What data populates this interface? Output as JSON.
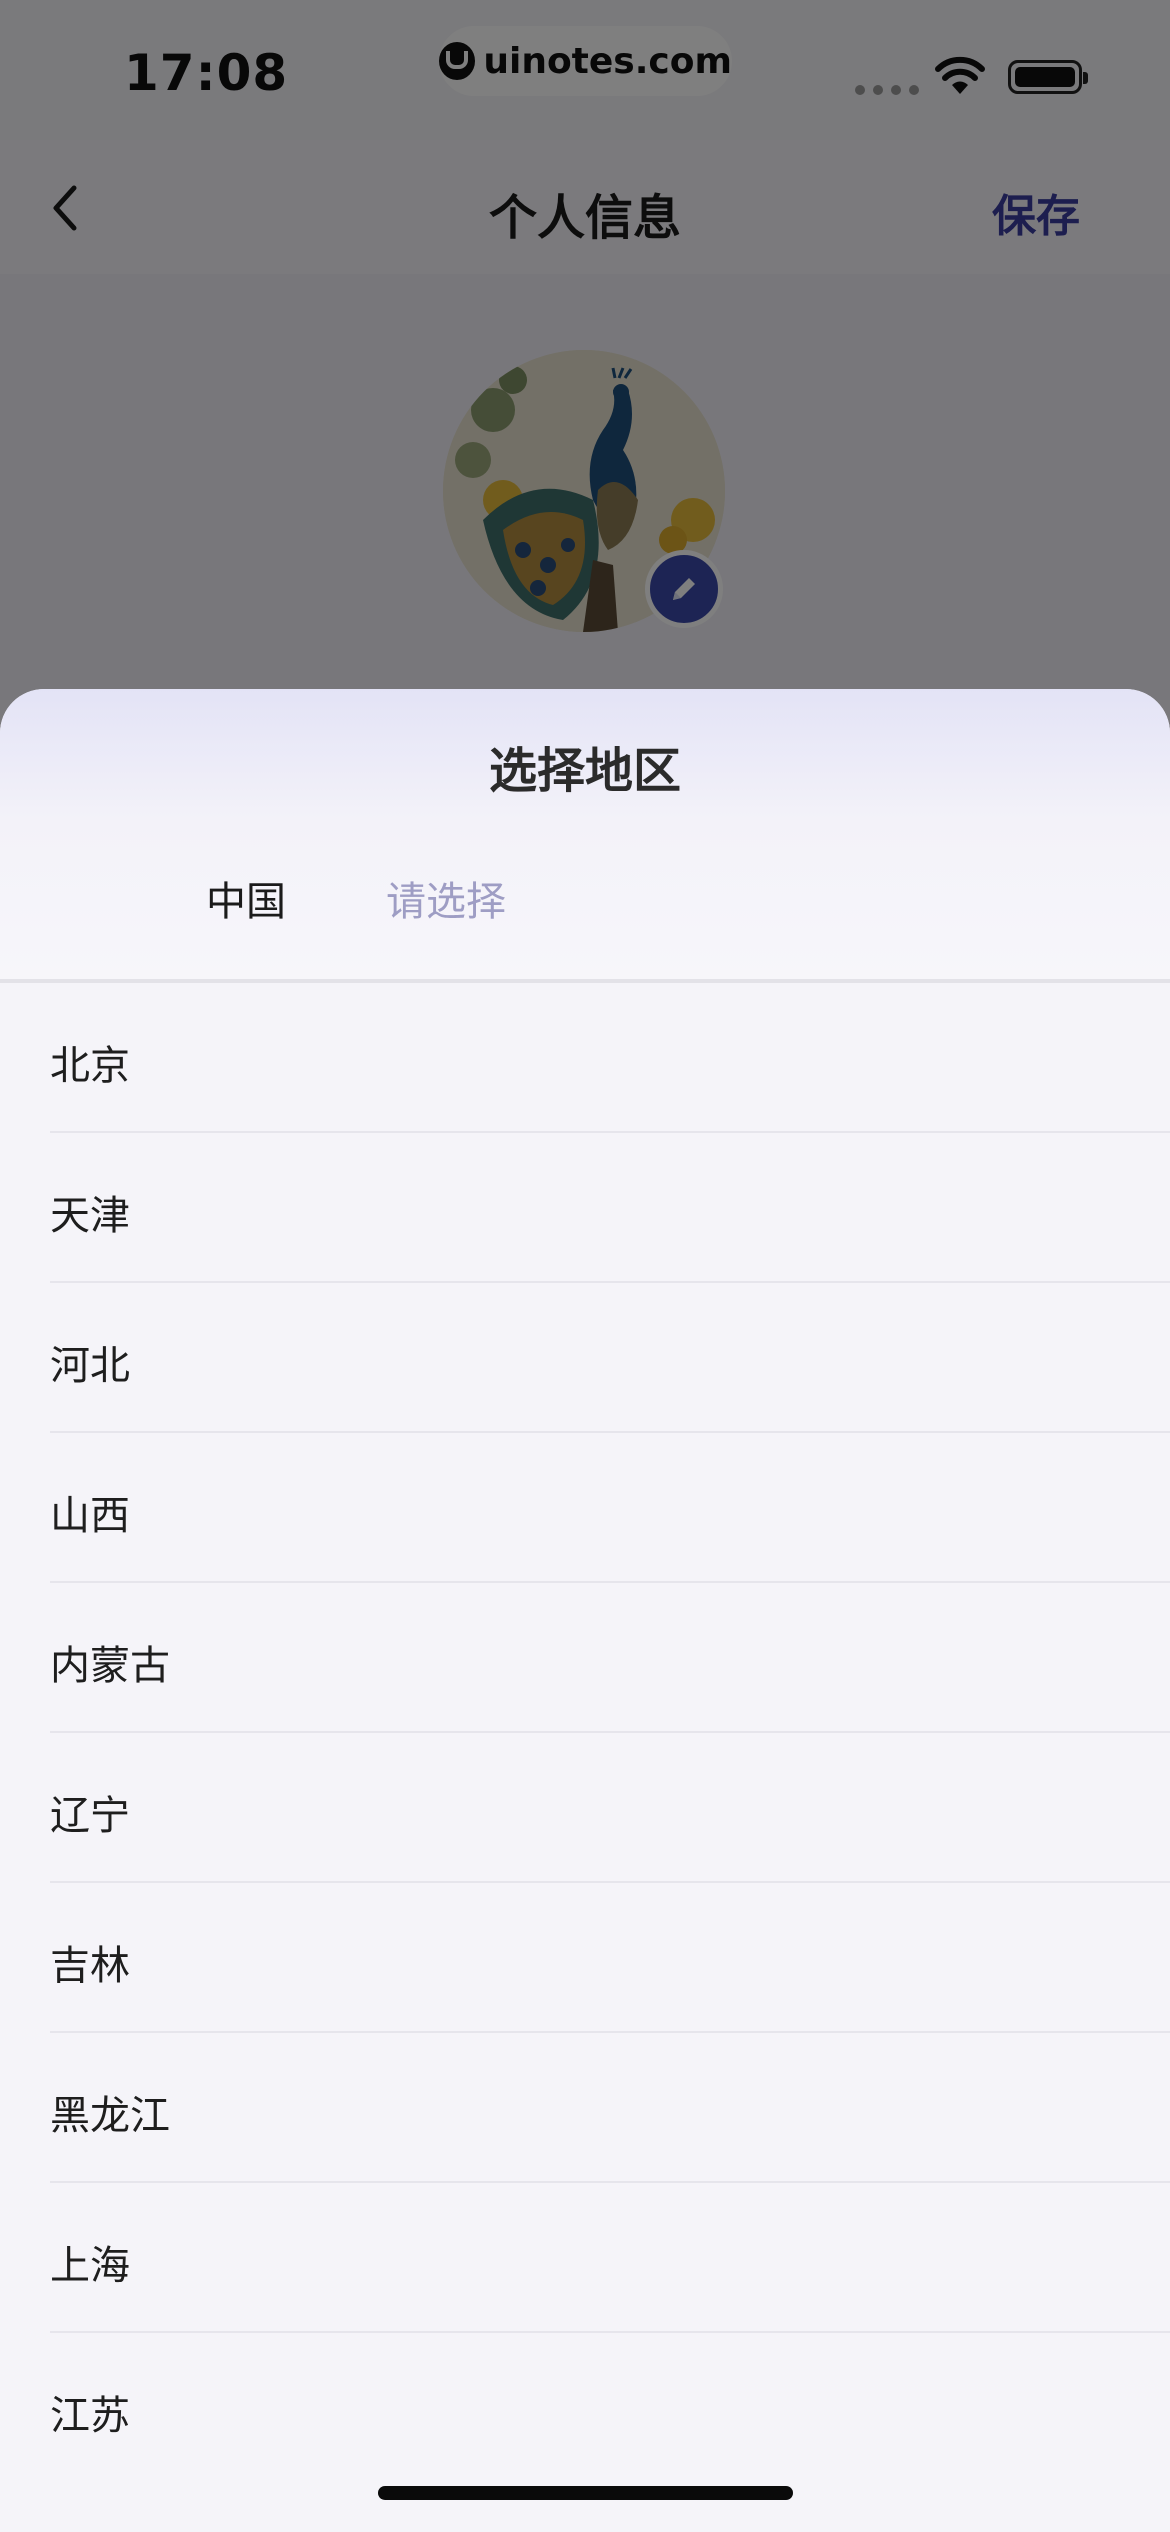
{
  "status_bar": {
    "time": "17:08",
    "url": "uinotes.com"
  },
  "nav": {
    "back_icon": "chevron-left-icon",
    "title": "个人信息",
    "save_label": "保存",
    "save_color": "#3b3c9e"
  },
  "profile": {
    "avatar_alt": "peacock-avatar",
    "edit_icon": "pencil-icon"
  },
  "sheet": {
    "title": "选择地区",
    "tabs": [
      {
        "label": "中国",
        "state": "selected"
      },
      {
        "label": "请选择",
        "state": "pending"
      }
    ],
    "pending_color": "#9e9dc4",
    "regions": [
      "北京",
      "天津",
      "河北",
      "山西",
      "内蒙古",
      "辽宁",
      "吉林",
      "黑龙江",
      "上海",
      "江苏"
    ]
  }
}
